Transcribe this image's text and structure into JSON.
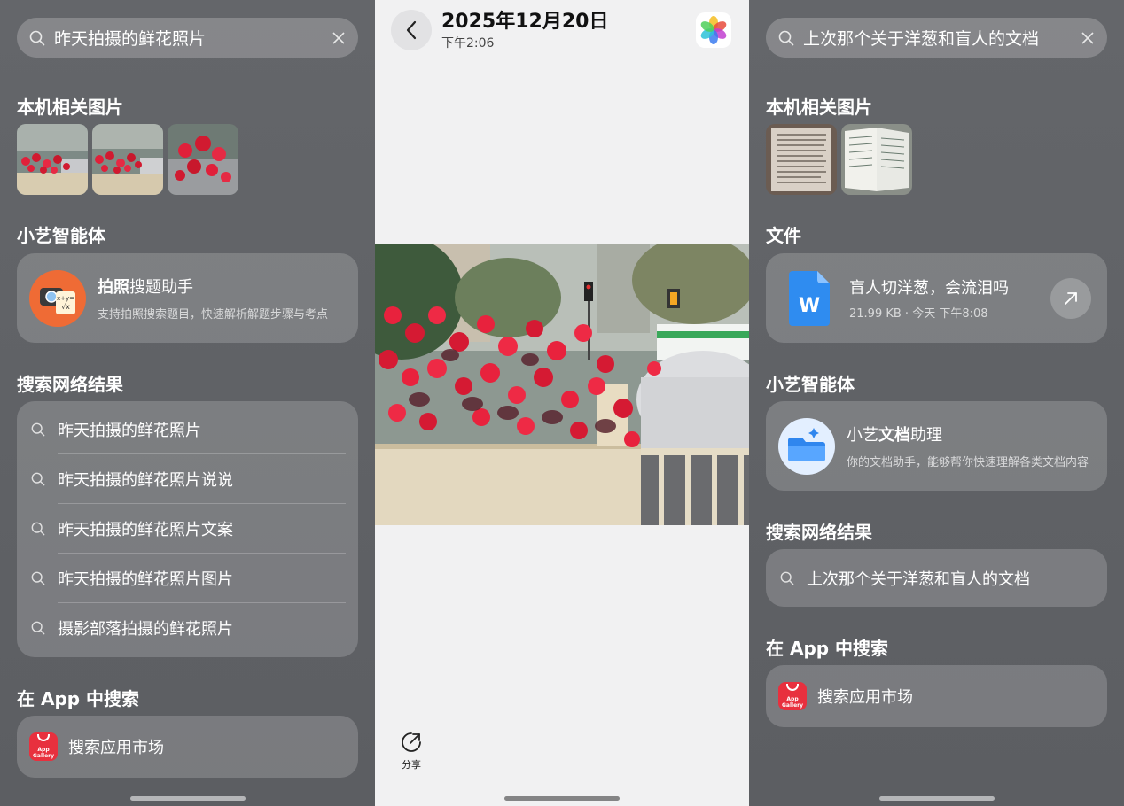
{
  "left": {
    "search_query": "昨天拍摄的鲜花照片",
    "local_images_title": "本机相关图片",
    "agents_title": "小艺智能体",
    "agent": {
      "name_bold": "拍照",
      "name_rest": "搜题助手",
      "desc": "支持拍照搜索题目，快速解析解题步骤与考点",
      "icon_text": "x+y=√x"
    },
    "web_title": "搜索网络结果",
    "web_results": [
      "昨天拍摄的鲜花照片",
      "昨天拍摄的鲜花照片说说",
      "昨天拍摄的鲜花照片文案",
      "昨天拍摄的鲜花照片图片",
      "摄影部落拍摄的鲜花照片"
    ],
    "in_app_title": "在 App 中搜索",
    "app_search_label": "搜索应用市场",
    "app_icon_label": "App Gallery"
  },
  "middle": {
    "date": "2025年12月20日",
    "time": "下午2:06",
    "share_label": "分享"
  },
  "right": {
    "search_query": "上次那个关于洋葱和盲人的文档",
    "local_images_title": "本机相关图片",
    "files_title": "文件",
    "file": {
      "name": "盲人切洋葱，会流泪吗",
      "meta": "21.99 KB · 今天 下午8:08",
      "icon_letter": "W"
    },
    "agents_title": "小艺智能体",
    "agent": {
      "name_plain_1": "小艺",
      "name_bold": "文档",
      "name_plain_2": "助理",
      "desc": "你的文档助手，能够帮你快速理解各类文档内容"
    },
    "web_title": "搜索网络结果",
    "web_result": "上次那个关于洋葱和盲人的文档",
    "in_app_title": "在 App 中搜索",
    "app_search_label": "搜索应用市场",
    "app_icon_label": "App Gallery"
  }
}
